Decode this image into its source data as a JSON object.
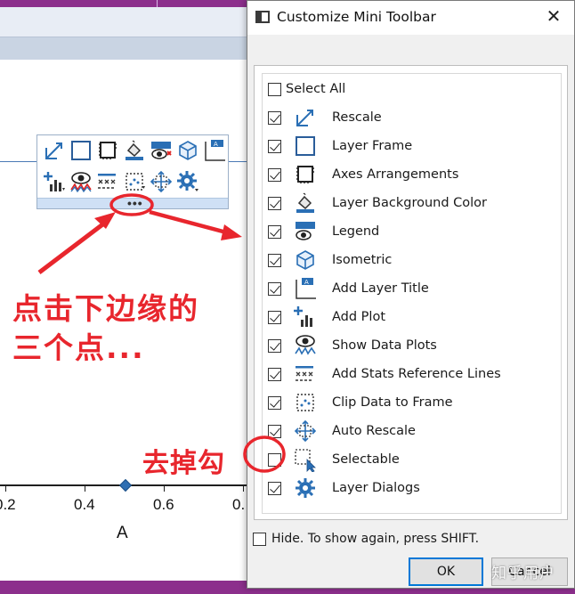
{
  "plot": {
    "tick_labels": [
      "0.2",
      "0.4",
      "0.6",
      "0."
    ],
    "axis_title": "A"
  },
  "mini_toolbar": {
    "dots": "•••"
  },
  "annotations": {
    "main_line1": "点击下边缘的",
    "main_line2": "三个点...",
    "remove_check": "去掉勾",
    "color": "#e8262d"
  },
  "dialog": {
    "title": "Customize Mini Toolbar",
    "close_glyph": "✕",
    "select_all": {
      "label": "Select All",
      "checked": false
    },
    "items": [
      {
        "label": "Rescale",
        "checked": true,
        "icon": "rescale-icon"
      },
      {
        "label": "Layer Frame",
        "checked": true,
        "icon": "layer-frame-icon"
      },
      {
        "label": "Axes Arrangements",
        "checked": true,
        "icon": "axes-arrangements-icon"
      },
      {
        "label": "Layer Background Color",
        "checked": true,
        "icon": "paint-bucket-icon"
      },
      {
        "label": "Legend",
        "checked": true,
        "icon": "legend-icon"
      },
      {
        "label": "Isometric",
        "checked": true,
        "icon": "isometric-cube-icon"
      },
      {
        "label": "Add Layer Title",
        "checked": true,
        "icon": "layer-title-icon"
      },
      {
        "label": "Add Plot",
        "checked": true,
        "icon": "add-plot-icon"
      },
      {
        "label": "Show Data Plots",
        "checked": true,
        "icon": "eye-plot-icon"
      },
      {
        "label": "Add Stats Reference Lines",
        "checked": true,
        "icon": "stats-lines-icon"
      },
      {
        "label": "Clip Data to Frame",
        "checked": true,
        "icon": "clip-frame-icon"
      },
      {
        "label": "Auto Rescale",
        "checked": true,
        "icon": "auto-rescale-icon"
      },
      {
        "label": "Selectable",
        "checked": false,
        "icon": "selectable-cursor-icon"
      },
      {
        "label": "Layer Dialogs",
        "checked": true,
        "icon": "gear-icon"
      }
    ],
    "hide_option": {
      "label": "Hide. To show again, press SHIFT.",
      "checked": false
    },
    "ok_label": "OK",
    "cancel_label": "Cancel"
  },
  "watermark": "知乎用户"
}
